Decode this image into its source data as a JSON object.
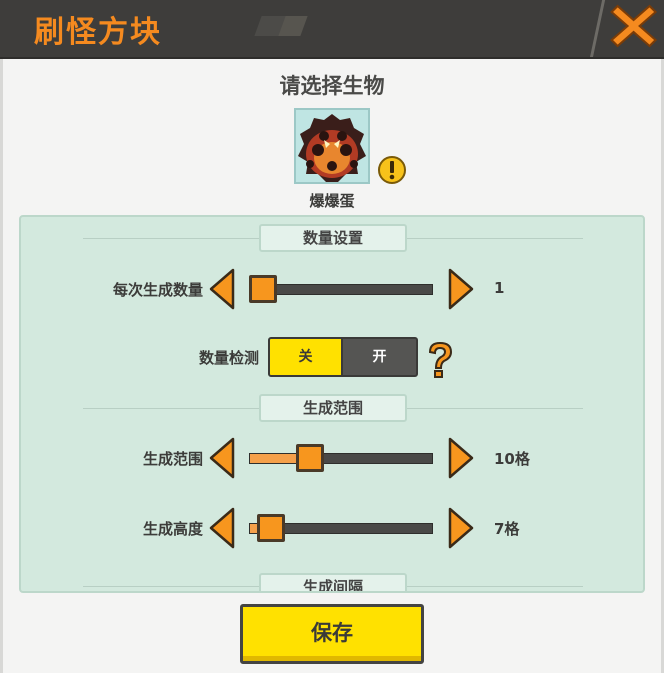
{
  "window": {
    "title": "刷怪方块"
  },
  "header": {
    "heading": "请选择生物"
  },
  "creature": {
    "name": "爆爆蛋",
    "icon": "bomb-egg-icon"
  },
  "sections": [
    {
      "label": "数量设置"
    },
    {
      "label": "生成范围"
    },
    {
      "label": "生成间隔"
    }
  ],
  "settings": {
    "spawn_count": {
      "label": "每次生成数量",
      "value": "1",
      "level": 0.0
    },
    "count_check": {
      "label": "数量检测",
      "off_label": "关",
      "on_label": "开",
      "selected": "关"
    },
    "spawn_range": {
      "label": "生成范围",
      "value": "10格",
      "level": 0.3
    },
    "spawn_height": {
      "label": "生成高度",
      "value": "7格",
      "level": 0.05
    }
  },
  "buttons": {
    "save_label": "保存"
  },
  "colors": {
    "accent": "#f58a1f",
    "button": "#ffe100",
    "panel": "#d3e9de",
    "titlebar": "#3e3d3b"
  }
}
